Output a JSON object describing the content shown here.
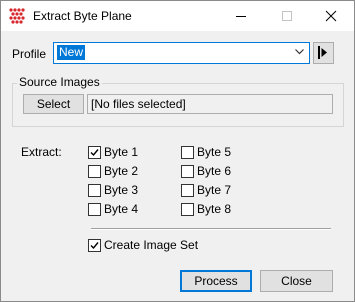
{
  "window": {
    "title": "Extract Byte Plane"
  },
  "profile": {
    "label": "Profile",
    "value": "New"
  },
  "source_images": {
    "group_label": "Source Images",
    "select_label": "Select",
    "files_text": "[No files selected]"
  },
  "extract": {
    "label": "Extract:",
    "bytes": [
      {
        "label": "Byte 1",
        "checked": true
      },
      {
        "label": "Byte 2",
        "checked": false
      },
      {
        "label": "Byte 3",
        "checked": false
      },
      {
        "label": "Byte 4",
        "checked": false
      },
      {
        "label": "Byte 5",
        "checked": false
      },
      {
        "label": "Byte 6",
        "checked": false
      },
      {
        "label": "Byte 7",
        "checked": false
      },
      {
        "label": "Byte 8",
        "checked": false
      }
    ]
  },
  "create_image_set": {
    "label": "Create Image Set",
    "checked": true
  },
  "buttons": {
    "process": "Process",
    "close": "Close"
  }
}
